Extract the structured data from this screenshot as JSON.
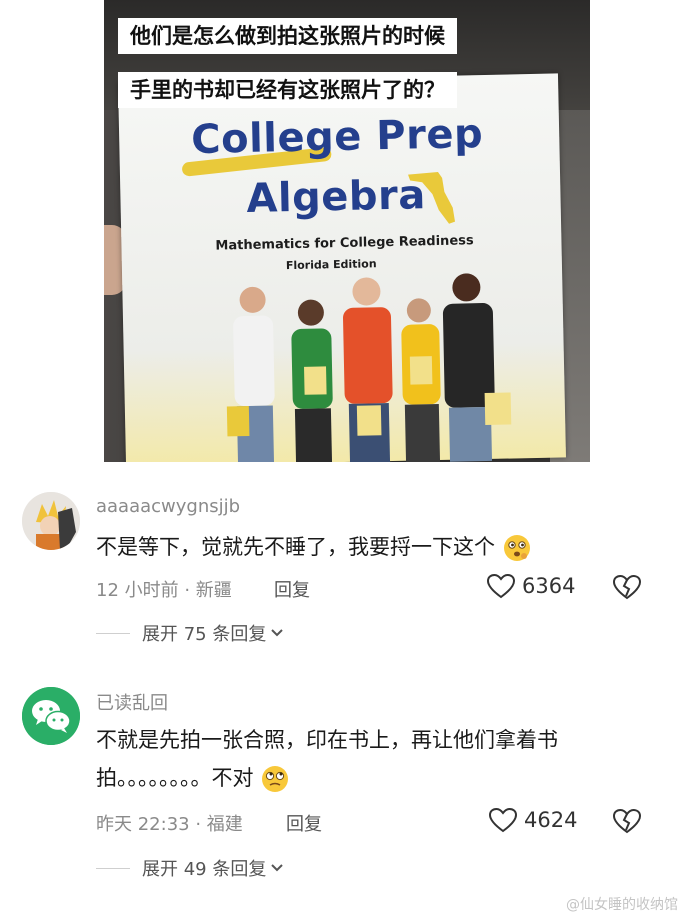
{
  "post": {
    "caption_line1": "他们是怎么做到拍这张照片的时候",
    "caption_line2": "手里的书却已经有这张照片了的？",
    "book": {
      "title_line1": "College Prep",
      "title_line2": "Algebra",
      "subtitle": "Mathematics for College Readiness",
      "edition": "Florida Edition"
    }
  },
  "comments": [
    {
      "username": "aaaaacwygnsjjb",
      "text": "不是等下，觉就先不睡了，我要捋一下这个",
      "emoji": "thinking-face",
      "time_location": "12 小时前 · 新疆",
      "reply_label": "回复",
      "likes": "6364",
      "expand_label": "展开 75 条回复"
    },
    {
      "username": "已读乱回",
      "text": "不就是先拍一张合照，印在书上，再让他们拿着书拍。。。。。。。。不对",
      "emoji": "rolling-eyes-face",
      "time_location": "昨天 22:33 · 福建",
      "reply_label": "回复",
      "likes": "4624",
      "expand_label": "展开 49 条回复"
    }
  ],
  "watermark": "@仙女睡的收纳馆",
  "colors": {
    "book_blue": "#243f8d",
    "accent_yellow": "#e9c93a",
    "wechat_green": "#2aae67"
  }
}
